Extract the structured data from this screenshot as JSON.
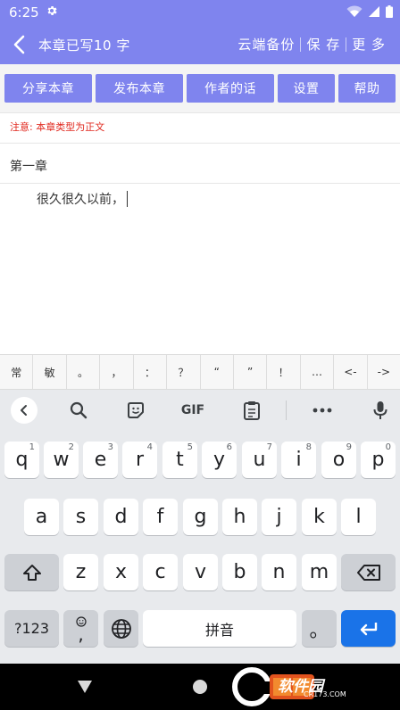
{
  "status_bar": {
    "time": "6:25"
  },
  "app_bar": {
    "title": "本章已写10 字",
    "actions": [
      "云端备份",
      "保 存",
      "更 多"
    ]
  },
  "toolbar": {
    "buttons": [
      "分享本章",
      "发布本章",
      "作者的话",
      "设置",
      "帮助"
    ]
  },
  "note": "注意: 本章类型为正文",
  "chapter": {
    "title": "第一章",
    "body": "很久很久以前，"
  },
  "symbol_row": [
    "常",
    "敏",
    "。",
    "，",
    "：",
    "？",
    "“",
    "”",
    "！",
    "…",
    "<-",
    "->"
  ],
  "keyboard": {
    "toolbar": {
      "gif_label": "GIF"
    },
    "row1": [
      {
        "k": "q",
        "h": "1"
      },
      {
        "k": "w",
        "h": "2"
      },
      {
        "k": "e",
        "h": "3"
      },
      {
        "k": "r",
        "h": "4"
      },
      {
        "k": "t",
        "h": "5"
      },
      {
        "k": "y",
        "h": "6"
      },
      {
        "k": "u",
        "h": "7"
      },
      {
        "k": "i",
        "h": "8"
      },
      {
        "k": "o",
        "h": "9"
      },
      {
        "k": "p",
        "h": "0"
      }
    ],
    "row2": [
      "a",
      "s",
      "d",
      "f",
      "g",
      "h",
      "j",
      "k",
      "l"
    ],
    "row3": [
      "z",
      "x",
      "c",
      "v",
      "b",
      "n",
      "m"
    ],
    "row4": {
      "mode": "?123",
      "comma": ",",
      "space": "拼音",
      "period": "。"
    }
  },
  "watermark": {
    "text": "软件园",
    "sub": "CR173.COM"
  },
  "colors": {
    "accent": "#7f84ee",
    "enter": "#1a73e8",
    "note": "#e0281e"
  }
}
